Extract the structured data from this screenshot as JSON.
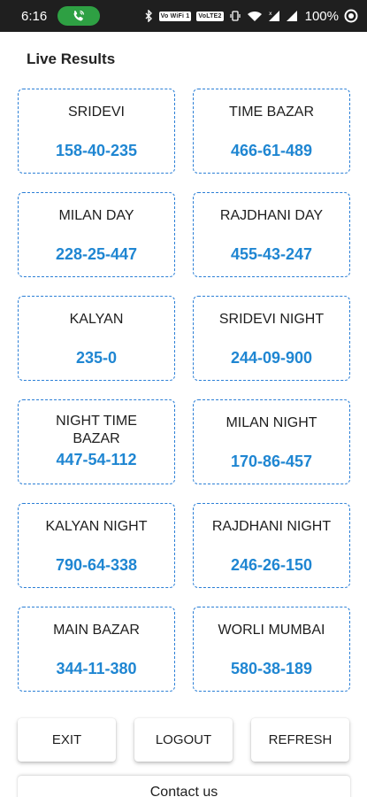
{
  "status_bar": {
    "time": "6:16",
    "call_icon": "phone-call-icon",
    "vowifi_label": "Vo WiFi 1",
    "volte_label": "VoLTE2",
    "battery_percent": "100%"
  },
  "header": {
    "title": "Live Results"
  },
  "results": [
    {
      "name": "SRIDEVI",
      "value": "158-40-235"
    },
    {
      "name": "TIME BAZAR",
      "value": "466-61-489"
    },
    {
      "name": "MILAN DAY",
      "value": "228-25-447"
    },
    {
      "name": "RAJDHANI DAY",
      "value": "455-43-247"
    },
    {
      "name": "KALYAN",
      "value": "235-0"
    },
    {
      "name": "SRIDEVI NIGHT",
      "value": "244-09-900"
    },
    {
      "name": "NIGHT TIME BAZAR",
      "value": "447-54-112"
    },
    {
      "name": "MILAN NIGHT",
      "value": "170-86-457"
    },
    {
      "name": "KALYAN NIGHT",
      "value": "790-64-338"
    },
    {
      "name": "RAJDHANI NIGHT",
      "value": "246-26-150"
    },
    {
      "name": "MAIN BAZAR",
      "value": "344-11-380"
    },
    {
      "name": "WORLI MUMBAI",
      "value": "580-38-189"
    }
  ],
  "actions": {
    "exit_label": "EXIT",
    "logout_label": "LOGOUT",
    "refresh_label": "REFRESH"
  },
  "contact_label": "Contact us",
  "colors": {
    "status_bar": "#1f1f1f",
    "call_pill": "#2ea043",
    "card_border": "#2b7fd6",
    "result_value": "#1f86d2"
  }
}
